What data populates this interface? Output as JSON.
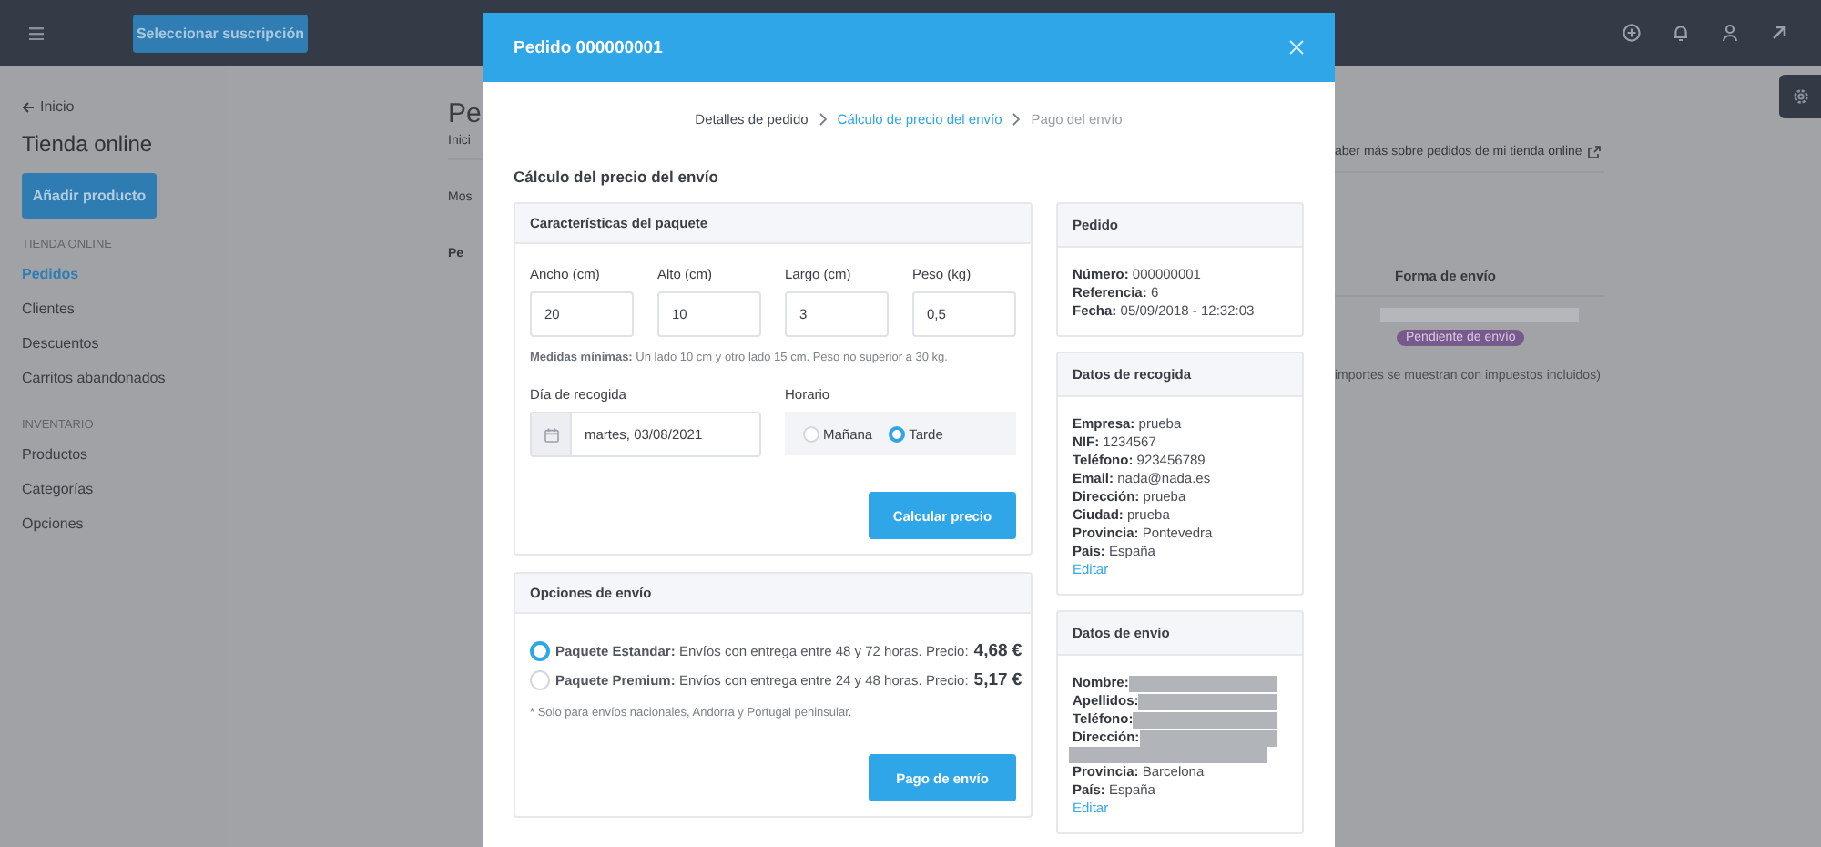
{
  "topbar": {
    "subscription_button": "Seleccionar suscripción"
  },
  "sidebar": {
    "back_link": "Inicio",
    "title": "Tienda online",
    "add_button": "Añadir producto",
    "sections": [
      {
        "heading": "TIENDA ONLINE",
        "items": [
          {
            "label": "Pedidos",
            "selected": true
          },
          {
            "label": "Clientes",
            "selected": false
          },
          {
            "label": "Descuentos",
            "selected": false
          },
          {
            "label": "Carritos abandonados",
            "selected": false
          }
        ]
      },
      {
        "heading": "INVENTARIO",
        "items": [
          {
            "label": "Productos",
            "selected": false
          },
          {
            "label": "Categorías",
            "selected": false
          },
          {
            "label": "Opciones",
            "selected": false
          }
        ]
      }
    ]
  },
  "background": {
    "page_title": "Pe",
    "breadcrumb": "Inici",
    "show_label": "Mos",
    "table_header": "Pe",
    "help_link": "aber más sobre pedidos de mi tienda online",
    "column_header": "Forma de envío",
    "status_badge": "Pendiente de envío",
    "footnote": "importes se muestran con impuestos incluidos)"
  },
  "modal": {
    "title": "Pedido 000000001",
    "steps": [
      {
        "label": "Detalles de pedido",
        "completed": true,
        "selected": false
      },
      {
        "label": "Cálculo de precio del envío",
        "completed": false,
        "selected": true
      },
      {
        "label": "Pago del envío",
        "completed": false,
        "selected": false
      }
    ],
    "section_title": "Cálculo del precio del envío",
    "package_card": {
      "title": "Características del paquete",
      "fields": [
        {
          "label": "Ancho (cm)",
          "value": "20"
        },
        {
          "label": "Alto (cm)",
          "value": "10"
        },
        {
          "label": "Largo (cm)",
          "value": "3"
        },
        {
          "label": "Peso (kg)",
          "value": "0,5"
        }
      ],
      "note": "**Medidas mínimas:** Un lado 10 cm y otro lado 15 cm. Peso no superior a 30 kg.",
      "pickup_day": {
        "label": "Día de recogida",
        "value": "martes, 03/08/2021"
      },
      "schedule": {
        "label": "Horario",
        "options": [
          {
            "label": "Mañana",
            "selected": false
          },
          {
            "label": "Tarde",
            "selected": true
          }
        ]
      },
      "calculate_button": "Calcular precio"
    },
    "shipping_card": {
      "title": "Opciones de envío",
      "options": [
        {
          "text": "**Paquete Estandar:** Envíos con entrega entre 48 y 72 horas. Precio:",
          "price": "4,68 €",
          "selected": true
        },
        {
          "text": "**Paquete Premium:** Envíos con entrega entre 24 y 48 horas. Precio:",
          "price": "5,17 €",
          "selected": false
        }
      ],
      "note": "* Solo para envíos nacionales, Andorra y Portugal peninsular.",
      "pay_button": "Pago de envío"
    },
    "side_cards": [
      {
        "title": "Pedido",
        "lines": [
          {
            "text": "**Número:** 000000001"
          },
          {
            "text": "**Referencia:** 6"
          },
          {
            "text": "**Fecha:** 05/09/2018 - 12:32:03"
          }
        ]
      },
      {
        "title": "Datos de recogida",
        "lines": [
          {
            "text": "**Empresa:** prueba"
          },
          {
            "text": "**NIF:** 1234567"
          },
          {
            "text": "**Teléfono:** 923456789"
          },
          {
            "text": "**Email:** nada@nada.es"
          },
          {
            "text": "**Dirección:** prueba"
          },
          {
            "text": "**Ciudad:** prueba"
          },
          {
            "text": "**Provincia:** Pontevedra"
          },
          {
            "text": "**País:** España"
          }
        ],
        "edit_link": "Editar"
      },
      {
        "title": "Datos de envío",
        "lines": [
          {
            "text": "**Nombre:**",
            "redacted": true
          },
          {
            "text": "**Apellidos:**",
            "redacted": true
          },
          {
            "text": "**Teléfono:**",
            "redacted": true
          },
          {
            "text": "**Dirección:**",
            "redacted": true,
            "wraps": true
          },
          {
            "text": "**Provincia:** Barcelona"
          },
          {
            "text": "**País:** España"
          }
        ],
        "edit_link": "Editar"
      }
    ]
  }
}
